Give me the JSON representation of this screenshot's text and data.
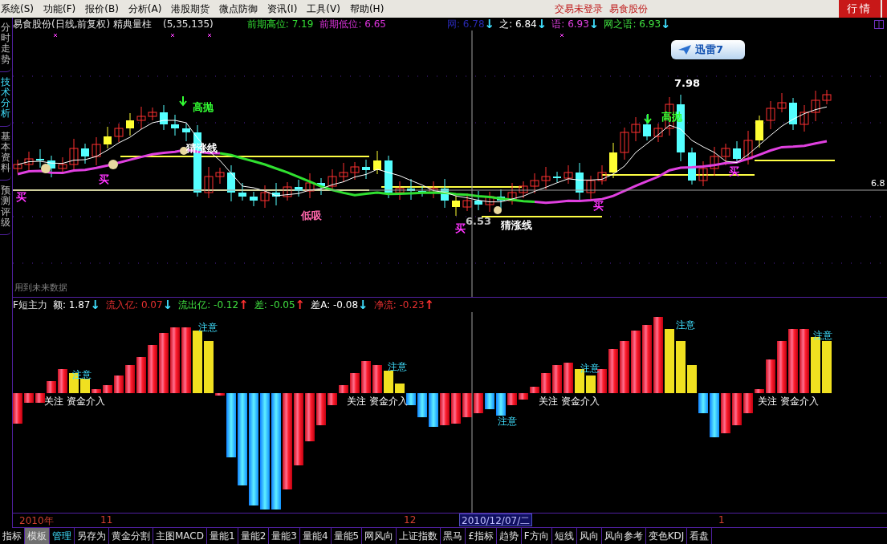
{
  "menu_bar": {
    "menus": [
      "系统(S)",
      "功能(F)",
      "报价(B)",
      "分析(A)",
      "港股期货",
      "微点防御",
      "资讯(I)",
      "工具(V)",
      "帮助(H)"
    ],
    "status": [
      "交易未登录",
      "易食股份"
    ],
    "button": "行情"
  },
  "sidebar": {
    "tabs": [
      {
        "label": "分时走势",
        "selected": false
      },
      {
        "label": "技术分析",
        "selected": true
      },
      {
        "label": "基本资料",
        "selected": false
      },
      {
        "label": "预测评级",
        "selected": false
      }
    ]
  },
  "main_chart": {
    "title": "易食股份(日线,前复权) 精典量柱",
    "params": "(5,35,135)",
    "levels": [
      {
        "label": "前期高位:",
        "value": "7.19",
        "color": "#33dd33"
      },
      {
        "label": "前期低位:",
        "value": "6.65",
        "color": "#dd33dd"
      }
    ],
    "ma_readings": [
      {
        "label": "网:",
        "value": "6.78",
        "arrow": {
          "text": "↓",
          "color": "#40e0ff"
        },
        "color": "#2828b0"
      },
      {
        "label": "之:",
        "value": "6.84",
        "arrow": {
          "text": "↓",
          "color": "#40e0ff"
        },
        "color": "#ffffff"
      },
      {
        "label": "语:",
        "value": "6.93",
        "arrow": {
          "text": "↓",
          "color": "#40e0ff"
        },
        "color": "#e040e0"
      },
      {
        "label": "网之语:",
        "value": "6.93",
        "arrow": {
          "text": "↓",
          "color": "#40e0ff"
        },
        "color": "#40e040"
      }
    ],
    "annotations": [
      {
        "text": "高抛",
        "color": "#33ff33"
      },
      {
        "text": "猜涨线",
        "color": "#ffffff"
      },
      {
        "text": "低吸",
        "color": "#ff66aa"
      },
      {
        "text": "买",
        "color": "#ff33ff"
      },
      {
        "text": "买",
        "color": "#ff33ff"
      },
      {
        "text": "买",
        "color": "#ff33ff"
      },
      {
        "text": "6.53",
        "color": "#c0c0c0"
      },
      {
        "text": "猜涨线",
        "color": "#ffffff"
      },
      {
        "text": "买",
        "color": "#ff33ff"
      },
      {
        "text": "7.98",
        "color": "#ffffff"
      },
      {
        "text": "高抛",
        "color": "#33ff33"
      },
      {
        "text": "买",
        "color": "#ff33ff"
      }
    ],
    "price_tag": "6.8",
    "note": "用到未来数据",
    "popup": "迅雷7"
  },
  "indicator": {
    "name": "F短主力",
    "readings": [
      {
        "label": "额:",
        "value": "1.87",
        "arrow": {
          "text": "↓",
          "color": "#40e0ff"
        },
        "color": "#ffffff"
      },
      {
        "label": "流入亿:",
        "value": "0.07",
        "arrow": {
          "text": "↓",
          "color": "#40e0ff"
        },
        "color": "#e83030"
      },
      {
        "label": "流出亿:",
        "value": "-0.12",
        "arrow": {
          "text": "↑",
          "color": "#ff3030"
        },
        "color": "#40e040"
      },
      {
        "label": "差:",
        "value": "-0.05",
        "arrow": {
          "text": "↑",
          "color": "#ff3030"
        },
        "color": "#40e040"
      },
      {
        "label": "差A:",
        "value": "-0.08",
        "arrow": {
          "text": "↓",
          "color": "#40e0ff"
        },
        "color": "#ffffff"
      },
      {
        "label": "净流:",
        "value": "-0.23",
        "arrow": {
          "text": "↑",
          "color": "#ff3030"
        },
        "color": "#e83030"
      }
    ],
    "annotations": [
      {
        "text": "注意",
        "kind": "warn"
      },
      {
        "text": "注意",
        "kind": "warn"
      },
      {
        "text": "注意",
        "kind": "warn"
      },
      {
        "text": "注意",
        "kind": "warn"
      },
      {
        "text": "注意",
        "kind": "warn"
      },
      {
        "text": "注意",
        "kind": "warn"
      },
      {
        "text": "注意",
        "kind": "warn"
      },
      {
        "text": "关注 资金介入",
        "kind": "watch"
      },
      {
        "text": "关注 资金介入",
        "kind": "watch"
      },
      {
        "text": "关注 资金介入",
        "kind": "watch"
      },
      {
        "text": "关注 资金介入",
        "kind": "watch"
      }
    ]
  },
  "time_axis": {
    "labels": [
      "2010年",
      "11",
      "12",
      "1"
    ],
    "cursor_date": "2010/12/07/二"
  },
  "bottom_tabs": [
    {
      "label": "指标",
      "selected": false,
      "highlight": false
    },
    {
      "label": "模板",
      "selected": true,
      "highlight": false
    },
    {
      "label": "管理",
      "selected": false,
      "highlight": true
    },
    {
      "label": "另存为",
      "selected": false,
      "highlight": false
    },
    {
      "label": "黄金分割",
      "selected": false,
      "highlight": false
    },
    {
      "label": "主图MACD",
      "selected": false,
      "highlight": false
    },
    {
      "label": "量能1",
      "selected": false,
      "highlight": false
    },
    {
      "label": "量能2",
      "selected": false,
      "highlight": false
    },
    {
      "label": "量能3",
      "selected": false,
      "highlight": false
    },
    {
      "label": "量能4",
      "selected": false,
      "highlight": false
    },
    {
      "label": "量能5",
      "selected": false,
      "highlight": false
    },
    {
      "label": "网风向",
      "selected": false,
      "highlight": false
    },
    {
      "label": "上证指数",
      "selected": false,
      "highlight": false
    },
    {
      "label": "黑马",
      "selected": false,
      "highlight": false
    },
    {
      "label": "£指标",
      "selected": false,
      "highlight": false
    },
    {
      "label": "趋势",
      "selected": false,
      "highlight": false
    },
    {
      "label": "F方向",
      "selected": false,
      "highlight": false
    },
    {
      "label": "短线",
      "selected": false,
      "highlight": false
    },
    {
      "label": "风向",
      "selected": false,
      "highlight": false
    },
    {
      "label": "风向参考",
      "selected": false,
      "highlight": false
    },
    {
      "label": "变色KDJ",
      "selected": false,
      "highlight": false
    },
    {
      "label": "看盘",
      "selected": false,
      "highlight": false
    }
  ]
}
